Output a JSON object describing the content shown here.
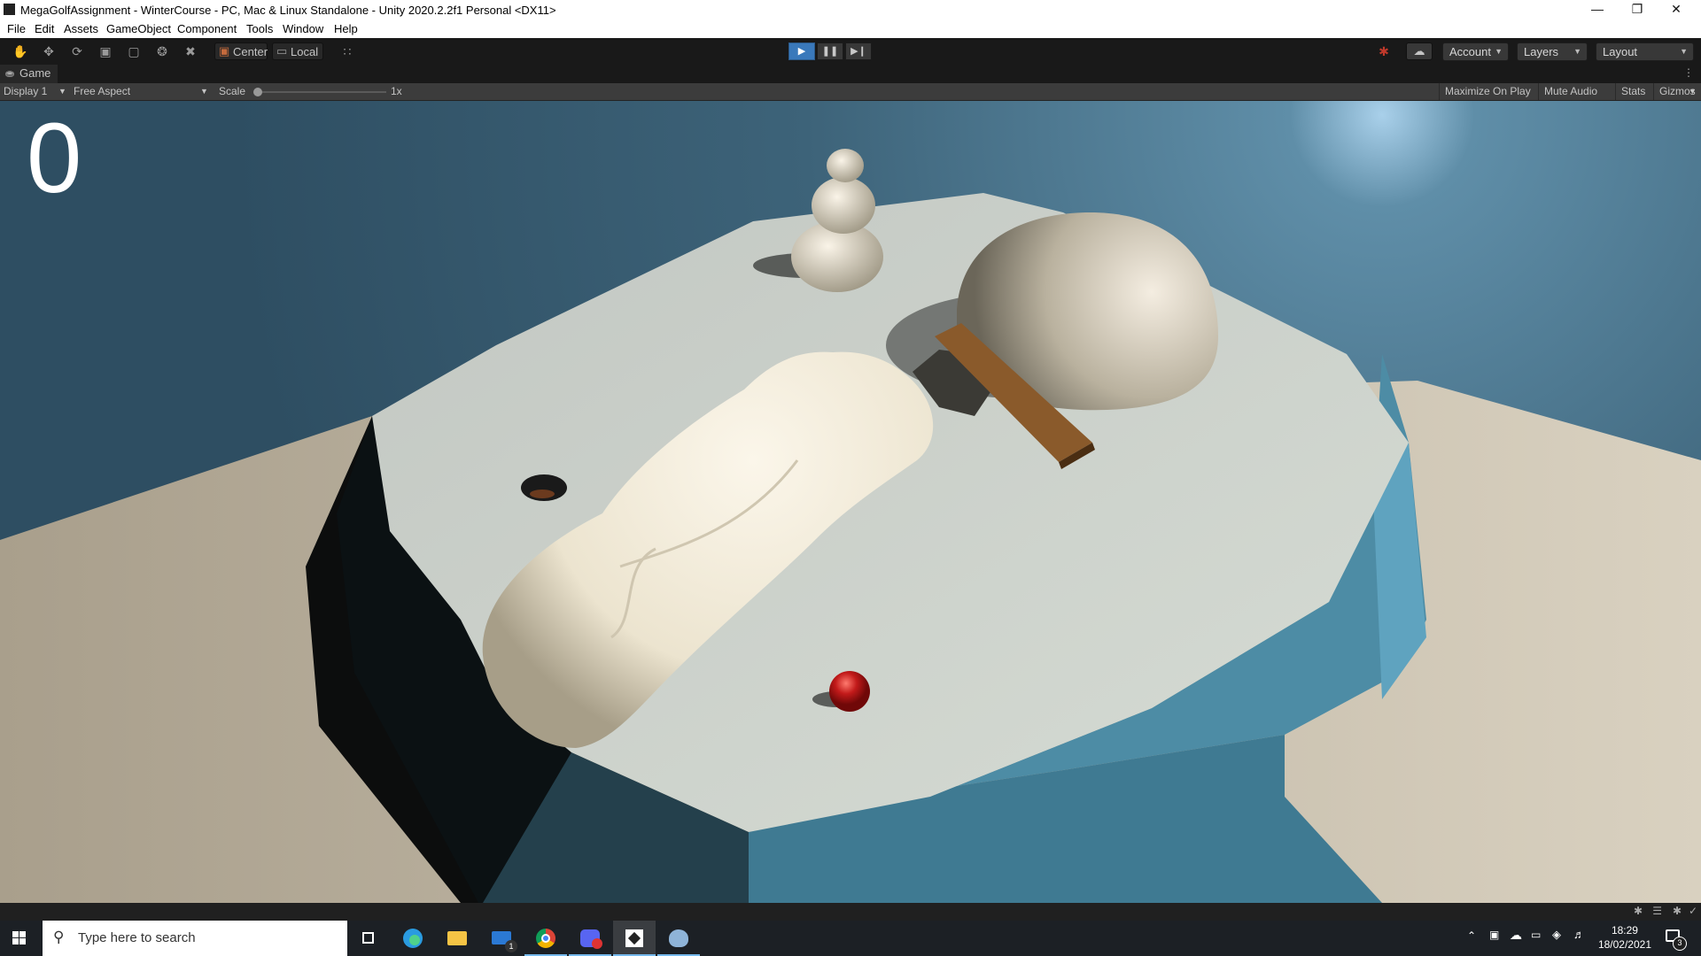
{
  "window": {
    "title": "MegaGolfAssignment - WinterCourse - PC, Mac & Linux Standalone - Unity 2020.2.2f1 Personal <DX11>"
  },
  "menu": [
    "File",
    "Edit",
    "Assets",
    "GameObject",
    "Component",
    "Tools",
    "Window",
    "Help"
  ],
  "toolbar": {
    "pivot_label": "Center",
    "space_label": "Local",
    "account_label": "Account",
    "layers_label": "Layers",
    "layout_label": "Layout"
  },
  "game_view": {
    "tab_label": "Game",
    "display": "Display 1",
    "aspect": "Free Aspect",
    "scale_label": "Scale",
    "scale_value": "1x",
    "maximize_label": "Maximize On Play",
    "mute_label": "Mute Audio",
    "stats_label": "Stats",
    "gizmos_label": "Gizmos",
    "score": "0"
  },
  "taskbar": {
    "search_placeholder": "Type here to search",
    "time": "18:29",
    "date": "18/02/2021",
    "mail_badge": "1",
    "notification_count": "3"
  },
  "colors": {
    "play_active": "#3a79bb",
    "editor_bg": "#191919",
    "sky": "#3a5f75",
    "ice_top": "#d4d8cf",
    "ice_side": "#4d8ca5",
    "ball": "#c21a1a"
  }
}
